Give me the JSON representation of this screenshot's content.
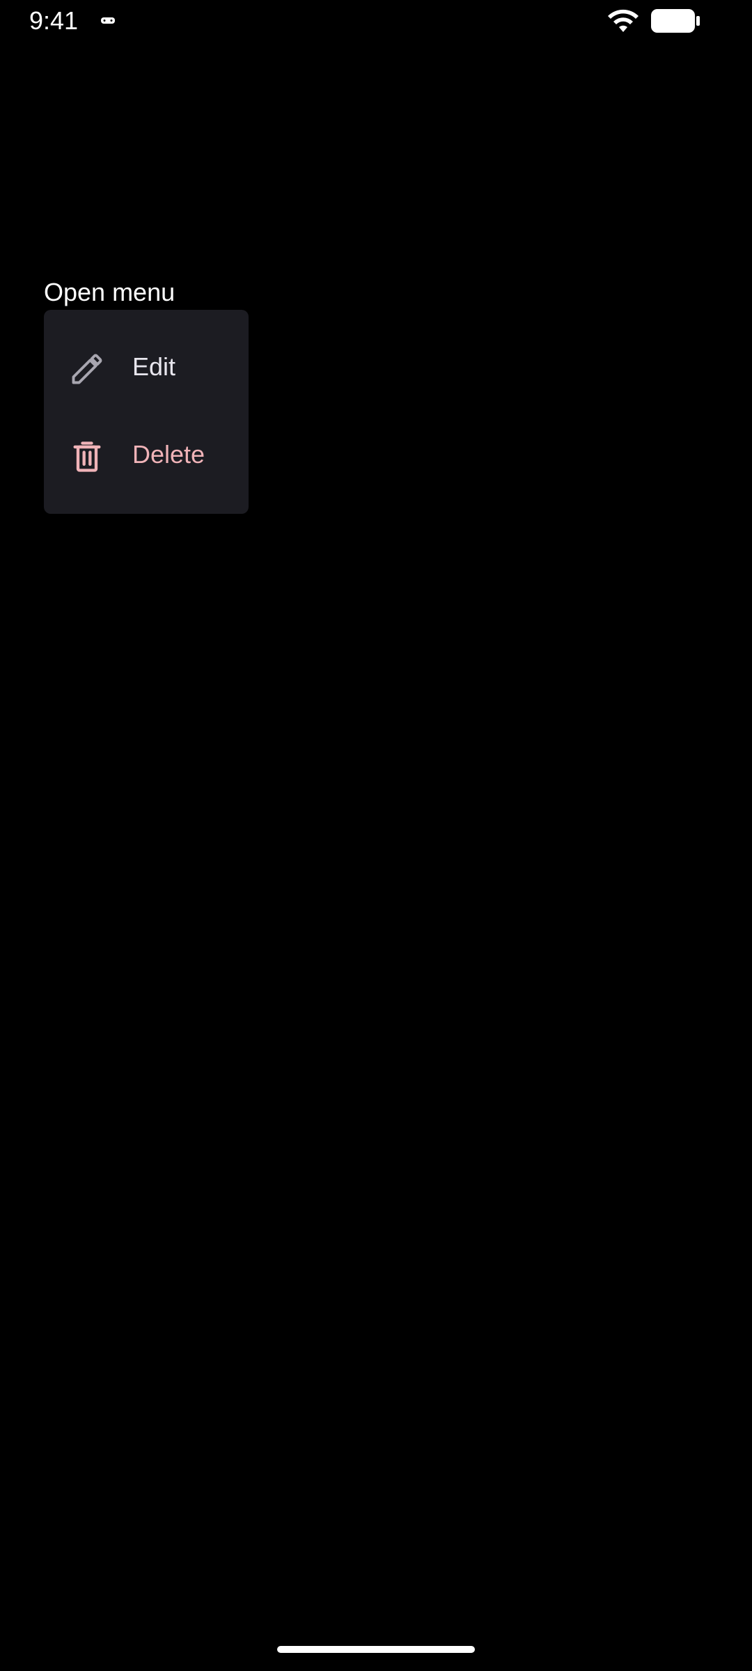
{
  "status_bar": {
    "time": "9:41",
    "notification_icon": "game-controller-icon",
    "wifi_icon": "wifi-icon",
    "battery_icon": "battery-icon"
  },
  "trigger": {
    "label": "Open menu"
  },
  "menu": {
    "items": [
      {
        "label": "Edit",
        "icon": "pencil-icon",
        "color": "#e8e6ee",
        "icon_color": "#a8a6b0"
      },
      {
        "label": "Delete",
        "icon": "trash-icon",
        "color": "#f0b3b8",
        "icon_color": "#f0b3b8"
      }
    ]
  },
  "colors": {
    "background": "#000000",
    "menu_surface": "#1c1c22",
    "destructive": "#f0b3b8"
  }
}
